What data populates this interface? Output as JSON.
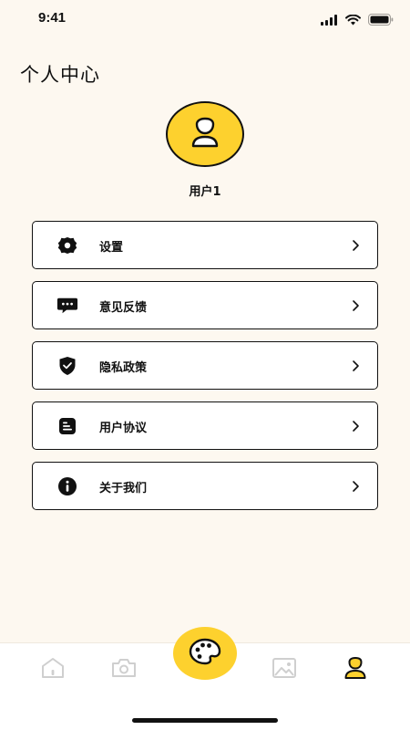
{
  "status_bar": {
    "time": "9:41"
  },
  "header": {
    "title": "个人中心"
  },
  "profile": {
    "username": "用户1"
  },
  "menu": [
    {
      "label": "设置",
      "icon": "gear-icon"
    },
    {
      "label": "意见反馈",
      "icon": "feedback-icon"
    },
    {
      "label": "隐私政策",
      "icon": "shield-check-icon"
    },
    {
      "label": "用户协议",
      "icon": "document-icon"
    },
    {
      "label": "关于我们",
      "icon": "info-icon"
    }
  ],
  "bottom_nav": {
    "items": [
      {
        "icon": "home-icon",
        "active": false
      },
      {
        "icon": "camera-icon",
        "active": false
      },
      {
        "icon": "palette-icon",
        "active": false
      },
      {
        "icon": "image-icon",
        "active": false
      },
      {
        "icon": "profile-icon",
        "active": true
      }
    ]
  },
  "colors": {
    "accent": "#fdd12e",
    "background": "#fdf8f0",
    "ink": "#111111",
    "inactive": "#cfcfcf"
  }
}
